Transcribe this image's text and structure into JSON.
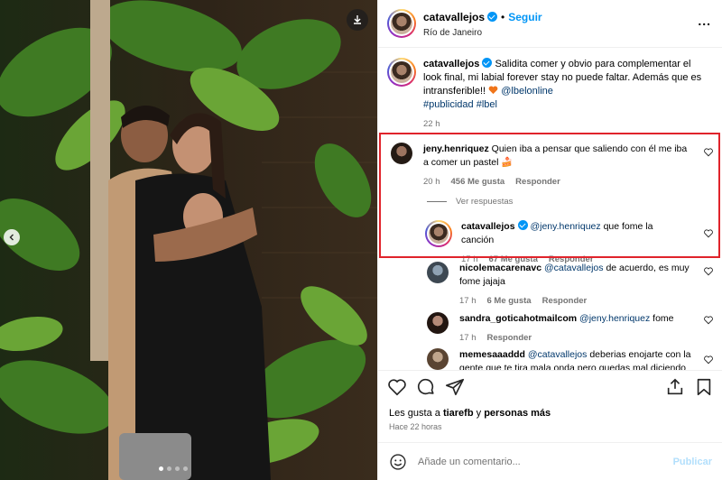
{
  "post_author": {
    "username": "catavallejos",
    "follow_label": "Seguir",
    "separator": "•",
    "location": "Río de Janeiro",
    "more_label": "..."
  },
  "caption": {
    "username": "catavallejos",
    "text": "Salidita comer y obvio para complementar el look final, mi labial forever stay no puede faltar. Además que es intransferible!!",
    "mention": "@lbelonline",
    "hashtags": "#publicidad #lbel",
    "time": "22 h"
  },
  "comments": [
    {
      "username": "jeny.henriquez",
      "text": "Quien iba a pensar que saliendo con él me iba a comer un pastel 🍰",
      "time": "20 h",
      "likes": "456 Me gusta",
      "reply_label": "Responder"
    },
    {
      "username": "catavallejos",
      "mention": "@jeny.henriquez",
      "text": "que fome la canción",
      "time": "17 h",
      "likes": "67 Me gusta",
      "reply_label": "Responder"
    },
    {
      "username": "nicolemacarenavc",
      "mention": "@catavallejos",
      "text": "de acuerdo, es muy fome jajaja",
      "time": "17 h",
      "likes": "6 Me gusta",
      "reply_label": "Responder"
    },
    {
      "username": "sandra_goticahotmailcom",
      "mention": "@jeny.henriquez",
      "text": "fome",
      "time": "17 h",
      "reply_label": "Responder"
    },
    {
      "username": "memesaaaddd",
      "mention": "@catavallejos",
      "text": "deberias enojarte con la gente que te tira mala onda pero quedas mal diciendo",
      "time": ""
    }
  ],
  "view_replies_label": "Ver respuestas",
  "likes_summary": {
    "prefix": "Les gusta a",
    "user": "tiarefb",
    "joiner": "y",
    "others": "personas más"
  },
  "posted_ago": "Hace 22 horas",
  "comment_input": {
    "placeholder": "Añade un comentario...",
    "publish_label": "Publicar"
  },
  "icons": {
    "download": "download-icon",
    "prev": "chevron-left-icon",
    "like": "heart-icon",
    "comment": "comment-icon",
    "share": "send-icon",
    "save": "bookmark-icon",
    "emoji": "smiley-icon"
  },
  "colors": {
    "accent": "#0095f6",
    "highlight_border": "#e0232b",
    "muted": "#737373",
    "link": "#00376b",
    "publish_disabled": "#b2dffc",
    "orange_heart": "#f0751a"
  },
  "carousel": {
    "slide_count": 4,
    "active_index": 0
  }
}
